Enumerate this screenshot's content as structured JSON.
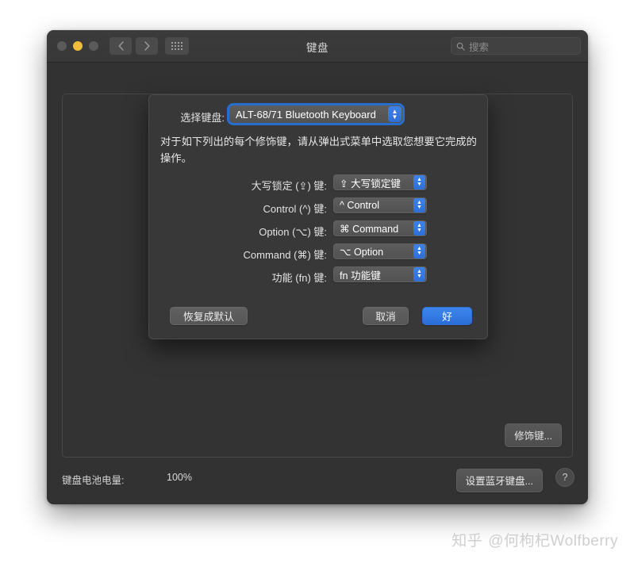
{
  "window": {
    "title": "键盘",
    "traffic_lights": [
      "close",
      "minimize",
      "zoom"
    ],
    "nav": {
      "back_icon": "chevron-left-icon",
      "forward_icon": "chevron-right-icon",
      "grid_icon": "all-preferences-grid-icon"
    },
    "search": {
      "placeholder": "搜索",
      "icon": "search-icon",
      "value": ""
    }
  },
  "panel": {
    "modifier_button": "修饰键..."
  },
  "bottom": {
    "battery_label": "键盘电池电量:",
    "battery_value": "100%",
    "bluetooth_button": "设置蓝牙键盘...",
    "help_button": "?"
  },
  "sheet": {
    "select_label": "选择键盘:",
    "selected_keyboard": "ALT-68/71 Bluetooth Keyboard",
    "description": "对于如下列出的每个修饰键，请从弹出式菜单中选取您想要它完成的操作。",
    "rows": [
      {
        "label": "大写锁定 (⇪) 键:",
        "value": "⇪ 大写锁定键"
      },
      {
        "label": "Control (^) 键:",
        "value": "^ Control"
      },
      {
        "label": "Option (⌥) 键:",
        "value": "⌘ Command"
      },
      {
        "label": "Command (⌘) 键:",
        "value": "⌥ Option"
      },
      {
        "label": "功能 (fn) 键:",
        "value": "fn 功能键"
      }
    ],
    "actions": {
      "restore": "恢复成默认",
      "cancel": "取消",
      "ok": "好"
    }
  },
  "watermark": {
    "logo": "知乎",
    "handle": "@何枸杞Wolfberry"
  },
  "colors": {
    "accent_blue": "#3d86ec",
    "window_bg": "#323232",
    "sheet_bg": "#383838",
    "yellow_light": "#f0bc3c"
  }
}
